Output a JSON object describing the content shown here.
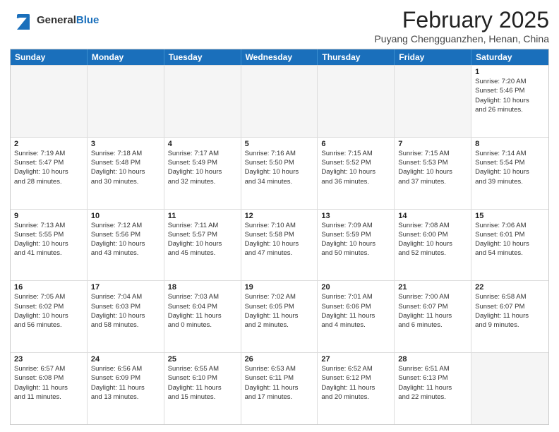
{
  "header": {
    "logo_general": "General",
    "logo_blue": "Blue",
    "month_year": "February 2025",
    "location": "Puyang Chengguanzhen, Henan, China"
  },
  "weekdays": [
    "Sunday",
    "Monday",
    "Tuesday",
    "Wednesday",
    "Thursday",
    "Friday",
    "Saturday"
  ],
  "rows": [
    [
      {
        "day": "",
        "empty": true
      },
      {
        "day": "",
        "empty": true
      },
      {
        "day": "",
        "empty": true
      },
      {
        "day": "",
        "empty": true
      },
      {
        "day": "",
        "empty": true
      },
      {
        "day": "",
        "empty": true
      },
      {
        "day": "1",
        "info": "Sunrise: 7:20 AM\nSunset: 5:46 PM\nDaylight: 10 hours\nand 26 minutes."
      }
    ],
    [
      {
        "day": "2",
        "info": "Sunrise: 7:19 AM\nSunset: 5:47 PM\nDaylight: 10 hours\nand 28 minutes."
      },
      {
        "day": "3",
        "info": "Sunrise: 7:18 AM\nSunset: 5:48 PM\nDaylight: 10 hours\nand 30 minutes."
      },
      {
        "day": "4",
        "info": "Sunrise: 7:17 AM\nSunset: 5:49 PM\nDaylight: 10 hours\nand 32 minutes."
      },
      {
        "day": "5",
        "info": "Sunrise: 7:16 AM\nSunset: 5:50 PM\nDaylight: 10 hours\nand 34 minutes."
      },
      {
        "day": "6",
        "info": "Sunrise: 7:15 AM\nSunset: 5:52 PM\nDaylight: 10 hours\nand 36 minutes."
      },
      {
        "day": "7",
        "info": "Sunrise: 7:15 AM\nSunset: 5:53 PM\nDaylight: 10 hours\nand 37 minutes."
      },
      {
        "day": "8",
        "info": "Sunrise: 7:14 AM\nSunset: 5:54 PM\nDaylight: 10 hours\nand 39 minutes."
      }
    ],
    [
      {
        "day": "9",
        "info": "Sunrise: 7:13 AM\nSunset: 5:55 PM\nDaylight: 10 hours\nand 41 minutes."
      },
      {
        "day": "10",
        "info": "Sunrise: 7:12 AM\nSunset: 5:56 PM\nDaylight: 10 hours\nand 43 minutes."
      },
      {
        "day": "11",
        "info": "Sunrise: 7:11 AM\nSunset: 5:57 PM\nDaylight: 10 hours\nand 45 minutes."
      },
      {
        "day": "12",
        "info": "Sunrise: 7:10 AM\nSunset: 5:58 PM\nDaylight: 10 hours\nand 47 minutes."
      },
      {
        "day": "13",
        "info": "Sunrise: 7:09 AM\nSunset: 5:59 PM\nDaylight: 10 hours\nand 50 minutes."
      },
      {
        "day": "14",
        "info": "Sunrise: 7:08 AM\nSunset: 6:00 PM\nDaylight: 10 hours\nand 52 minutes."
      },
      {
        "day": "15",
        "info": "Sunrise: 7:06 AM\nSunset: 6:01 PM\nDaylight: 10 hours\nand 54 minutes."
      }
    ],
    [
      {
        "day": "16",
        "info": "Sunrise: 7:05 AM\nSunset: 6:02 PM\nDaylight: 10 hours\nand 56 minutes."
      },
      {
        "day": "17",
        "info": "Sunrise: 7:04 AM\nSunset: 6:03 PM\nDaylight: 10 hours\nand 58 minutes."
      },
      {
        "day": "18",
        "info": "Sunrise: 7:03 AM\nSunset: 6:04 PM\nDaylight: 11 hours\nand 0 minutes."
      },
      {
        "day": "19",
        "info": "Sunrise: 7:02 AM\nSunset: 6:05 PM\nDaylight: 11 hours\nand 2 minutes."
      },
      {
        "day": "20",
        "info": "Sunrise: 7:01 AM\nSunset: 6:06 PM\nDaylight: 11 hours\nand 4 minutes."
      },
      {
        "day": "21",
        "info": "Sunrise: 7:00 AM\nSunset: 6:07 PM\nDaylight: 11 hours\nand 6 minutes."
      },
      {
        "day": "22",
        "info": "Sunrise: 6:58 AM\nSunset: 6:07 PM\nDaylight: 11 hours\nand 9 minutes."
      }
    ],
    [
      {
        "day": "23",
        "info": "Sunrise: 6:57 AM\nSunset: 6:08 PM\nDaylight: 11 hours\nand 11 minutes."
      },
      {
        "day": "24",
        "info": "Sunrise: 6:56 AM\nSunset: 6:09 PM\nDaylight: 11 hours\nand 13 minutes."
      },
      {
        "day": "25",
        "info": "Sunrise: 6:55 AM\nSunset: 6:10 PM\nDaylight: 11 hours\nand 15 minutes."
      },
      {
        "day": "26",
        "info": "Sunrise: 6:53 AM\nSunset: 6:11 PM\nDaylight: 11 hours\nand 17 minutes."
      },
      {
        "day": "27",
        "info": "Sunrise: 6:52 AM\nSunset: 6:12 PM\nDaylight: 11 hours\nand 20 minutes."
      },
      {
        "day": "28",
        "info": "Sunrise: 6:51 AM\nSunset: 6:13 PM\nDaylight: 11 hours\nand 22 minutes."
      },
      {
        "day": "",
        "empty": true
      }
    ]
  ]
}
